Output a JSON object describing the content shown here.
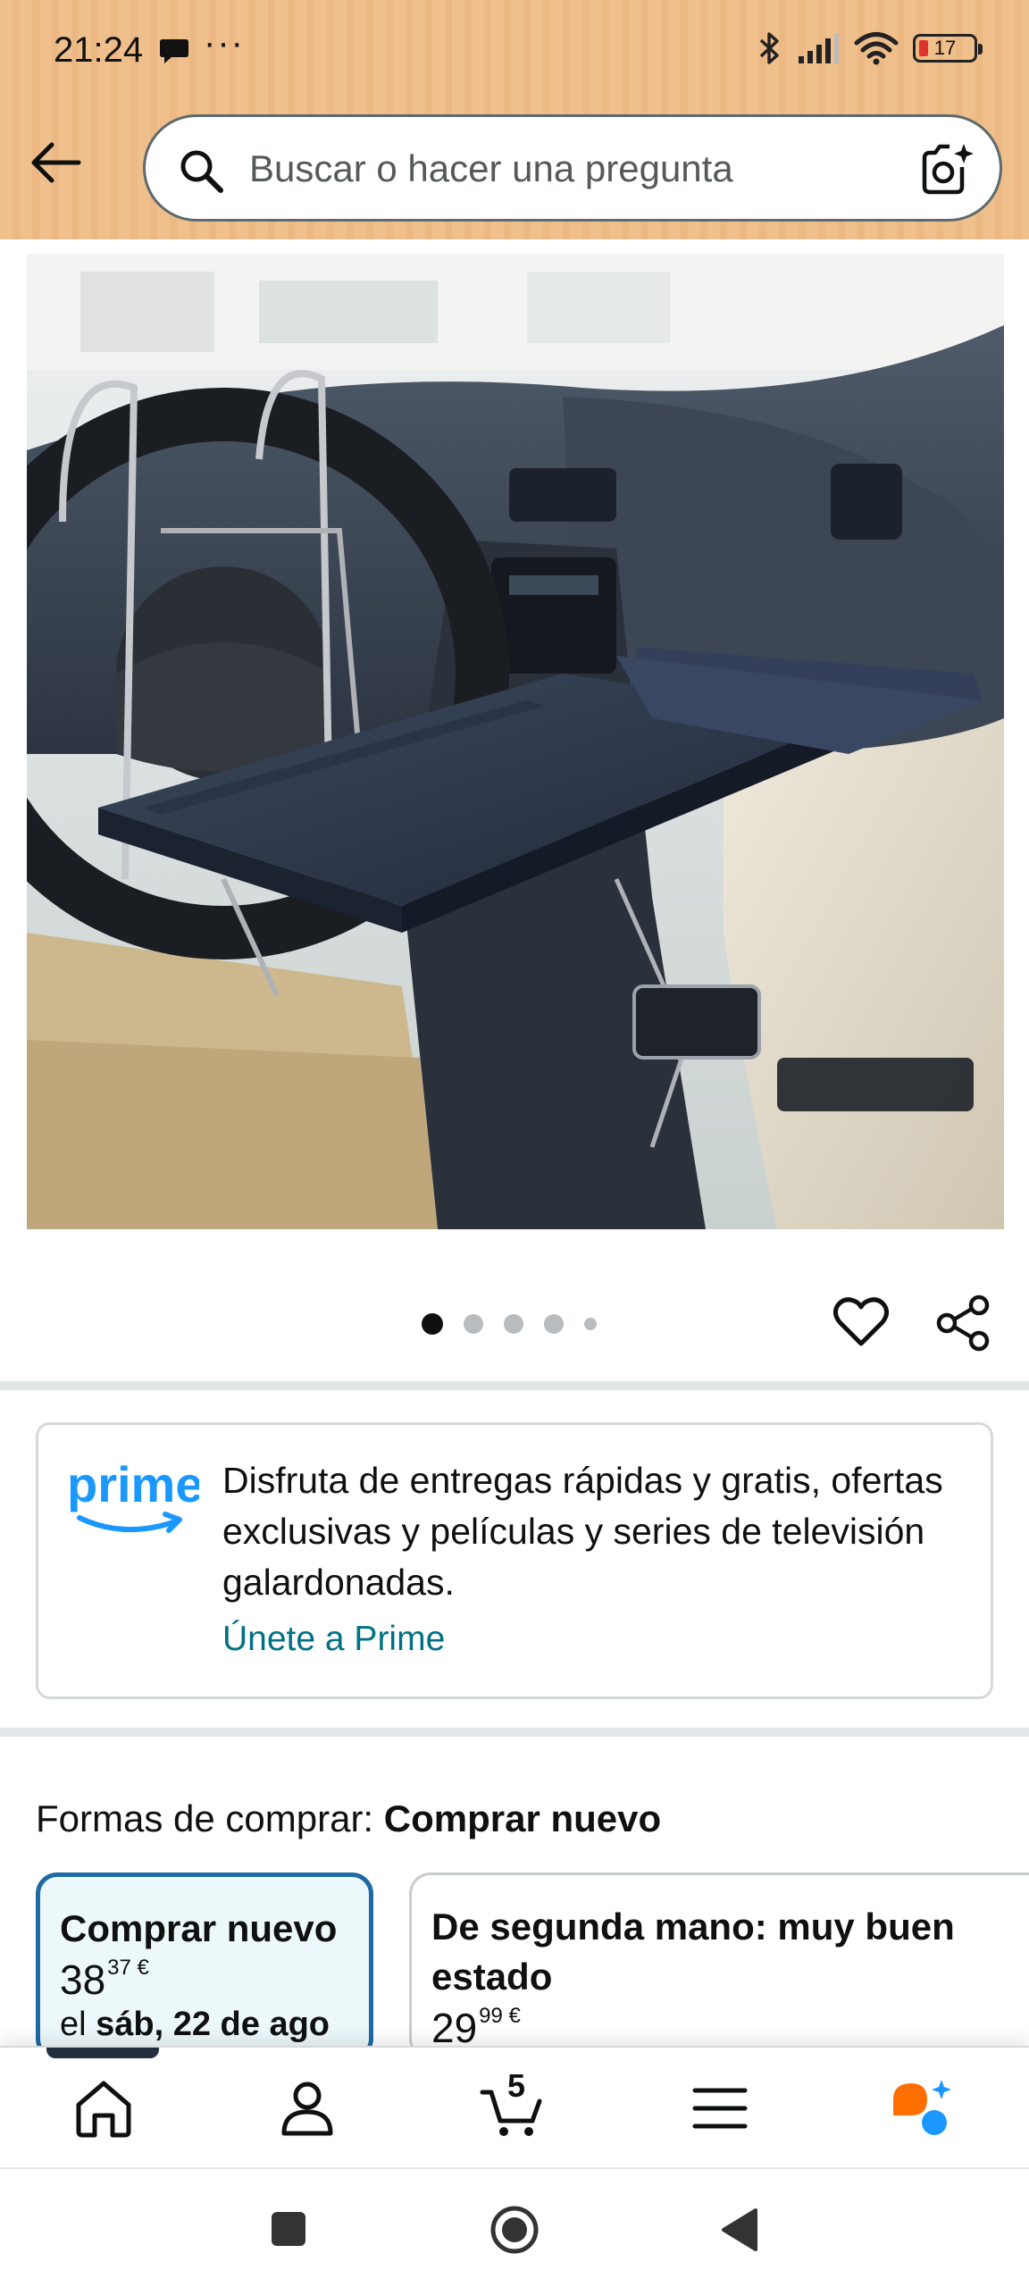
{
  "status_bar": {
    "time": "21:24",
    "more": "···",
    "battery_level": "17",
    "icons": [
      "message-icon",
      "bluetooth-icon",
      "signal-icon",
      "wifi-icon",
      "battery-icon"
    ]
  },
  "search": {
    "placeholder": "Buscar o hacer una pregunta"
  },
  "gallery": {
    "image_count": 5,
    "active_index": 0
  },
  "prime": {
    "logo_text": "prime",
    "description": "Disfruta de entregas rápidas y gratis, ofertas exclusivas y películas y series de televisión galardonadas.",
    "link": "Únete a Prime"
  },
  "buying_options": {
    "label": "Formas de comprar:",
    "selected": "Comprar nuevo",
    "new": {
      "title": "Comprar nuevo",
      "price_whole": "38",
      "price_fraction": "37",
      "currency": "€",
      "delivery_prefix": "el",
      "delivery_date": "sáb, 22 de ago"
    },
    "used": {
      "title_line1": "De segunda mano: muy buen",
      "title_line2": "estado",
      "price_whole": "29",
      "price_fraction": "99",
      "currency": "€"
    }
  },
  "bottom_nav": {
    "items": [
      "home-icon",
      "account-icon",
      "cart-icon",
      "menu-icon",
      "rufus-icon"
    ],
    "cart_count": "5"
  },
  "colors": {
    "header_bg": "#f0c08c",
    "link": "#007185",
    "selected_border": "#1d6aa5",
    "selected_bg": "#edf8fb",
    "prime_blue": "#1a98ff",
    "rufus_orange": "#ff6f00"
  }
}
